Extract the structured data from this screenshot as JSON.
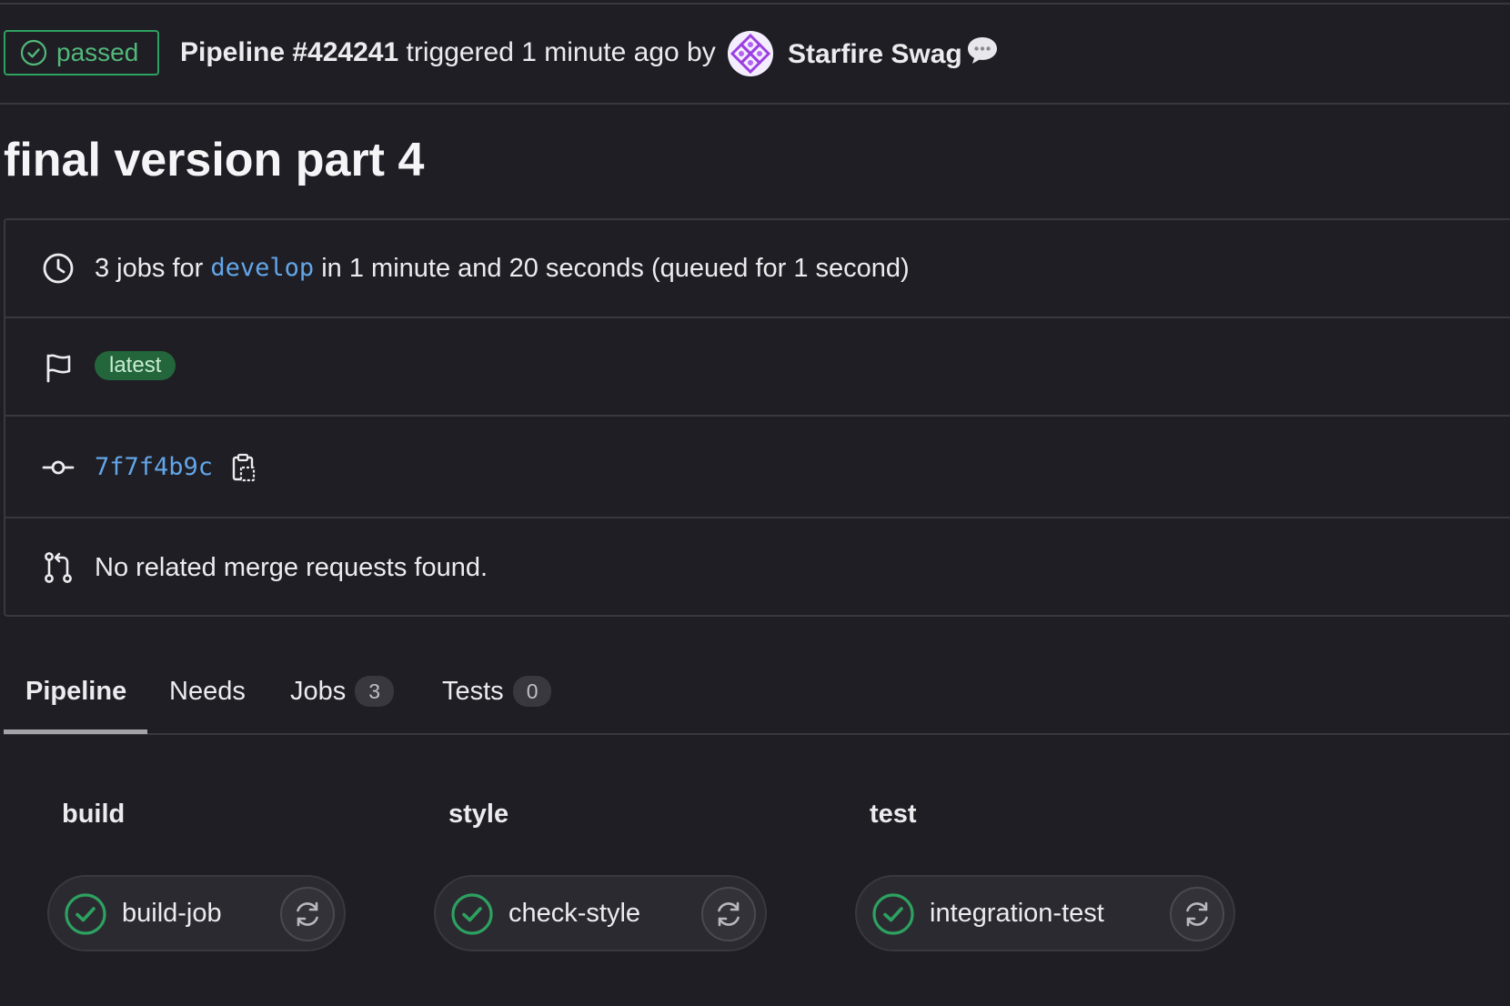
{
  "header": {
    "status": "passed",
    "pipeline_label": "Pipeline #424241",
    "triggered_text": "triggered 1 minute ago by",
    "author": "Starfire Swag"
  },
  "title": "final version part 4",
  "info": {
    "jobs_prefix": "3 jobs for",
    "branch": "develop",
    "jobs_suffix": "in 1 minute and 20 seconds (queued for 1 second)",
    "badge": "latest",
    "commit_sha": "7f7f4b9c",
    "merge_requests": "No related merge requests found."
  },
  "tabs": [
    {
      "label": "Pipeline"
    },
    {
      "label": "Needs"
    },
    {
      "label": "Jobs",
      "count": "3"
    },
    {
      "label": "Tests",
      "count": "0"
    }
  ],
  "stages": [
    {
      "name": "build",
      "job": "build-job"
    },
    {
      "name": "style",
      "job": "check-style"
    },
    {
      "name": "test",
      "job": "integration-test"
    }
  ],
  "colors": {
    "success": "#2da160",
    "link": "#63a6e9",
    "background": "#1f1e24"
  }
}
